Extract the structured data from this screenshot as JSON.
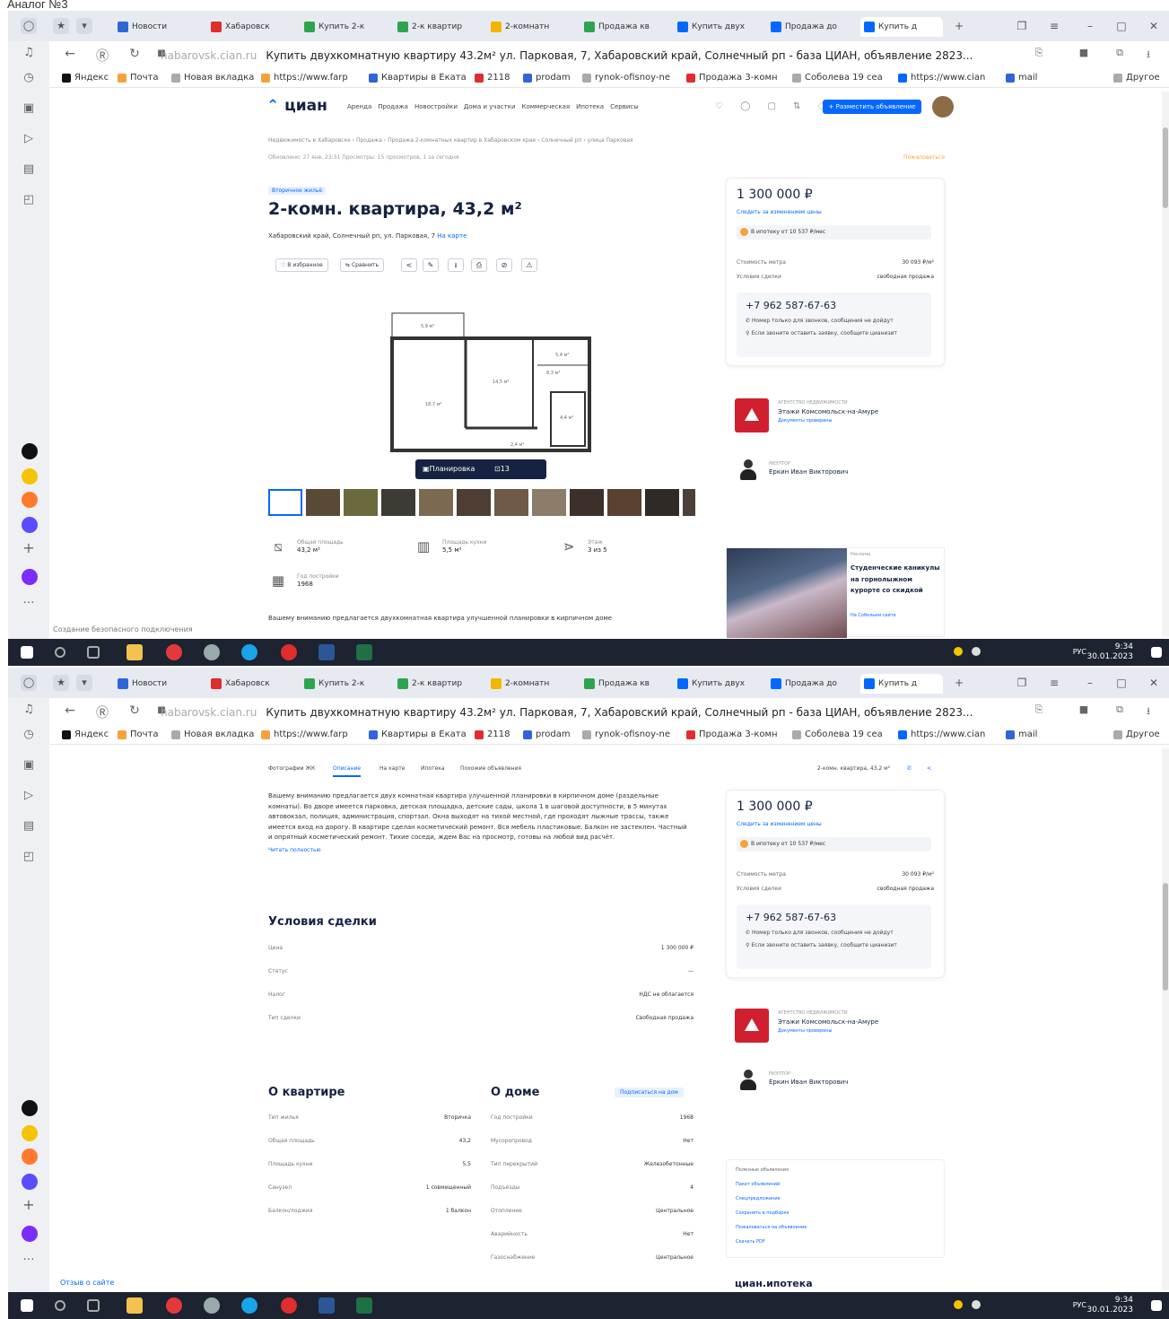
{
  "heading": "Аналог №3",
  "browser": {
    "tabs": [
      {
        "label": "Новости",
        "color": "#2f65d9"
      },
      {
        "label": "Хабаровск",
        "color": "#e02d2d"
      },
      {
        "label": "Купить 2-к",
        "color": "#2ea44f"
      },
      {
        "label": "2-к квартир",
        "color": "#2ea44f"
      },
      {
        "label": "2-комнатн",
        "color": "#f4b400"
      },
      {
        "label": "Продажа кв",
        "color": "#2ea44f"
      },
      {
        "label": "Купить двух",
        "color": "#0468ff"
      },
      {
        "label": "Продажа до",
        "color": "#0468ff"
      },
      {
        "label": "Купить д",
        "color": "#0468ff"
      }
    ],
    "url_domain": "habarovsk.cian.ru",
    "page_title": "Купить двухкомнатную квартиру 43.2м² ул. Парковая, 7, Хабаровский край, Солнечный рп - база ЦИАН, объявление 2823...",
    "bookmarks": [
      "Яндекс",
      "Почта",
      "Новая вкладка",
      "https://www.farp",
      "Квартиры в Еката",
      "2118",
      "prodam",
      "rynok-ofisnoy-ne",
      "Продажа 3-комн",
      "Соболева 19 сеа",
      "https://www.cian",
      "mail",
      "Другое"
    ],
    "status_text_1": "Создание безопасного подключения",
    "status_text_2": "Отзыв о сайте"
  },
  "taskbar": {
    "time": "9:34",
    "date": "30.01.2023",
    "lang": "РУС"
  },
  "cian": {
    "logo": "циан",
    "nav": [
      "Аренда",
      "Продажа",
      "Новостройки",
      "Дома и участки",
      "Коммерческая",
      "Ипотека",
      "Сервисы"
    ],
    "place_button": "+ Разместить объявление",
    "breadcrumbs": "Недвижимость в Хабаровске › Продажа › Продажа 2-комнатных квартир в Хабаровском крае › Солнечный рп › улица Парковая",
    "meta": "Обновлено: 27 янв, 23:31   Просмотры: 15 просмотров, 1 за сегодня",
    "complain": "Пожаловаться",
    "badge": "Вторичное жильё",
    "title": "2-комн. квартира, 43,2 м²",
    "address": "Хабаровский край, Солнечный рп, ул. Парковая, 7",
    "address_link": "На карте",
    "actions": {
      "favorite": "В избранное",
      "compare": "Сравнить"
    },
    "media": {
      "plan": "Планировка",
      "photos": "13 фото"
    },
    "plan_labels": [
      "5,9 м²",
      "14,5 м²",
      "8,3 м²",
      "18,7 м²",
      "5,4 м²",
      "4,4 м²",
      "2,4 м²"
    ],
    "features": [
      {
        "label": "Общая площадь",
        "value": "43,2 м²",
        "icon": "area-icon"
      },
      {
        "label": "Площадь кухни",
        "value": "5,5 м²",
        "icon": "kitchen-icon"
      },
      {
        "label": "Этаж",
        "value": "3 из 5",
        "icon": "floor-icon"
      },
      {
        "label": "Год постройки",
        "value": "1968",
        "icon": "building-icon"
      }
    ],
    "desc_teaser": "Вашему вниманию предлагается двухкомнатная квартира улучшенной планировки в кирпичном доме",
    "description": "Вашему вниманию предлагается двух комнатная квартира улучшенной планировки в кирпичном доме (раздельные комнаты). Во дворе имеется парковка, детская площадка, детские сады, школа 1 в шаговой доступности, в 5 минутах автовокзал, полиция, администрация, спортзал. Окна выходят на тихой местной, где проходят лыжные трассы, также имеется вход на дорогу. В квартире сделан косметический ремонт. Вся мебель пластиковые. Балкон не застеклен. Частный и опрятный косметический ремонт. Тихие соседи, ждем Вас на просмотр, готовы на любой вид расчёт.",
    "read_more": "Читать полностью",
    "subnav": [
      "Фотографии ЖК",
      "Описание",
      "На карте",
      "Ипотека",
      "Похожие объявления"
    ],
    "subnav_right": "2-комн. квартира, 43,2 м²",
    "price": "1 300 000 ₽",
    "price_watch": "Следить за изменением цены",
    "mortgage": "В ипотеку от 10 537 ₽/мес",
    "price_per_m": {
      "label": "Стоимость метра",
      "value": "30 093 ₽/м²"
    },
    "deal_terms_short": {
      "label": "Условия сделки",
      "value": "свободная продажа"
    },
    "phone": "+7 962 587-67-63",
    "phone_note_1": "Номер только для звонков, сообщения не дойдут",
    "phone_note_2": "Если звоните оставить заявку, сообщите цианизит",
    "agency": {
      "caption": "АГЕНТСТВО НЕДВИЖИМОСТИ",
      "name": "Этажи Комсомольск-на-Амуре",
      "sub": "Документы проверены"
    },
    "agent": {
      "caption": "РИЭЛТОР",
      "name": "Еркин Иван Викторович"
    },
    "ad": {
      "caption": "Реклама",
      "text": "Студенческие каникулы на горнолыжном курорте со скидкой",
      "link": "На Собольем сайте"
    },
    "deal": {
      "title": "Условия сделки",
      "rows": [
        {
          "k": "Цена",
          "v": "1 300 000 ₽"
        },
        {
          "k": "Статус",
          "v": "—"
        },
        {
          "k": "Налог",
          "v": "НДС не облагается"
        },
        {
          "k": "Тип сделки",
          "v": "Свободная продажа"
        }
      ]
    },
    "flat": {
      "title": "О квартире",
      "rows": [
        {
          "k": "Тип жилья",
          "v": "Вторичка"
        },
        {
          "k": "Общая площадь",
          "v": "43,2"
        },
        {
          "k": "Площадь кухни",
          "v": "5,5"
        },
        {
          "k": "Санузел",
          "v": "1 совмещенный"
        },
        {
          "k": "Балкон/лоджия",
          "v": "1 балкон"
        }
      ]
    },
    "house": {
      "title": "О доме",
      "link": "Подписаться на дом",
      "rows": [
        {
          "k": "Год постройки",
          "v": "1968"
        },
        {
          "k": "Мусоропровод",
          "v": "Нет"
        },
        {
          "k": "Тип перекрытий",
          "v": "Железобетонные"
        },
        {
          "k": "Подъезды",
          "v": "4"
        },
        {
          "k": "Отопление",
          "v": "Центральное"
        },
        {
          "k": "Аварийность",
          "v": "Нет"
        },
        {
          "k": "Газоснабжение",
          "v": "Центральное"
        }
      ]
    },
    "quicklinks": {
      "title": "Полезные объявления",
      "items": [
        "Пакет объявлений",
        "Спецпредложение",
        "Сохранить в подборке",
        "Пожаловаться на объявление",
        "Скачать PDF"
      ]
    },
    "ipoteka": "циан.ипотека"
  },
  "colors": {
    "accent": "#0468ff",
    "dark": "#152242",
    "agency": "#d02030"
  }
}
